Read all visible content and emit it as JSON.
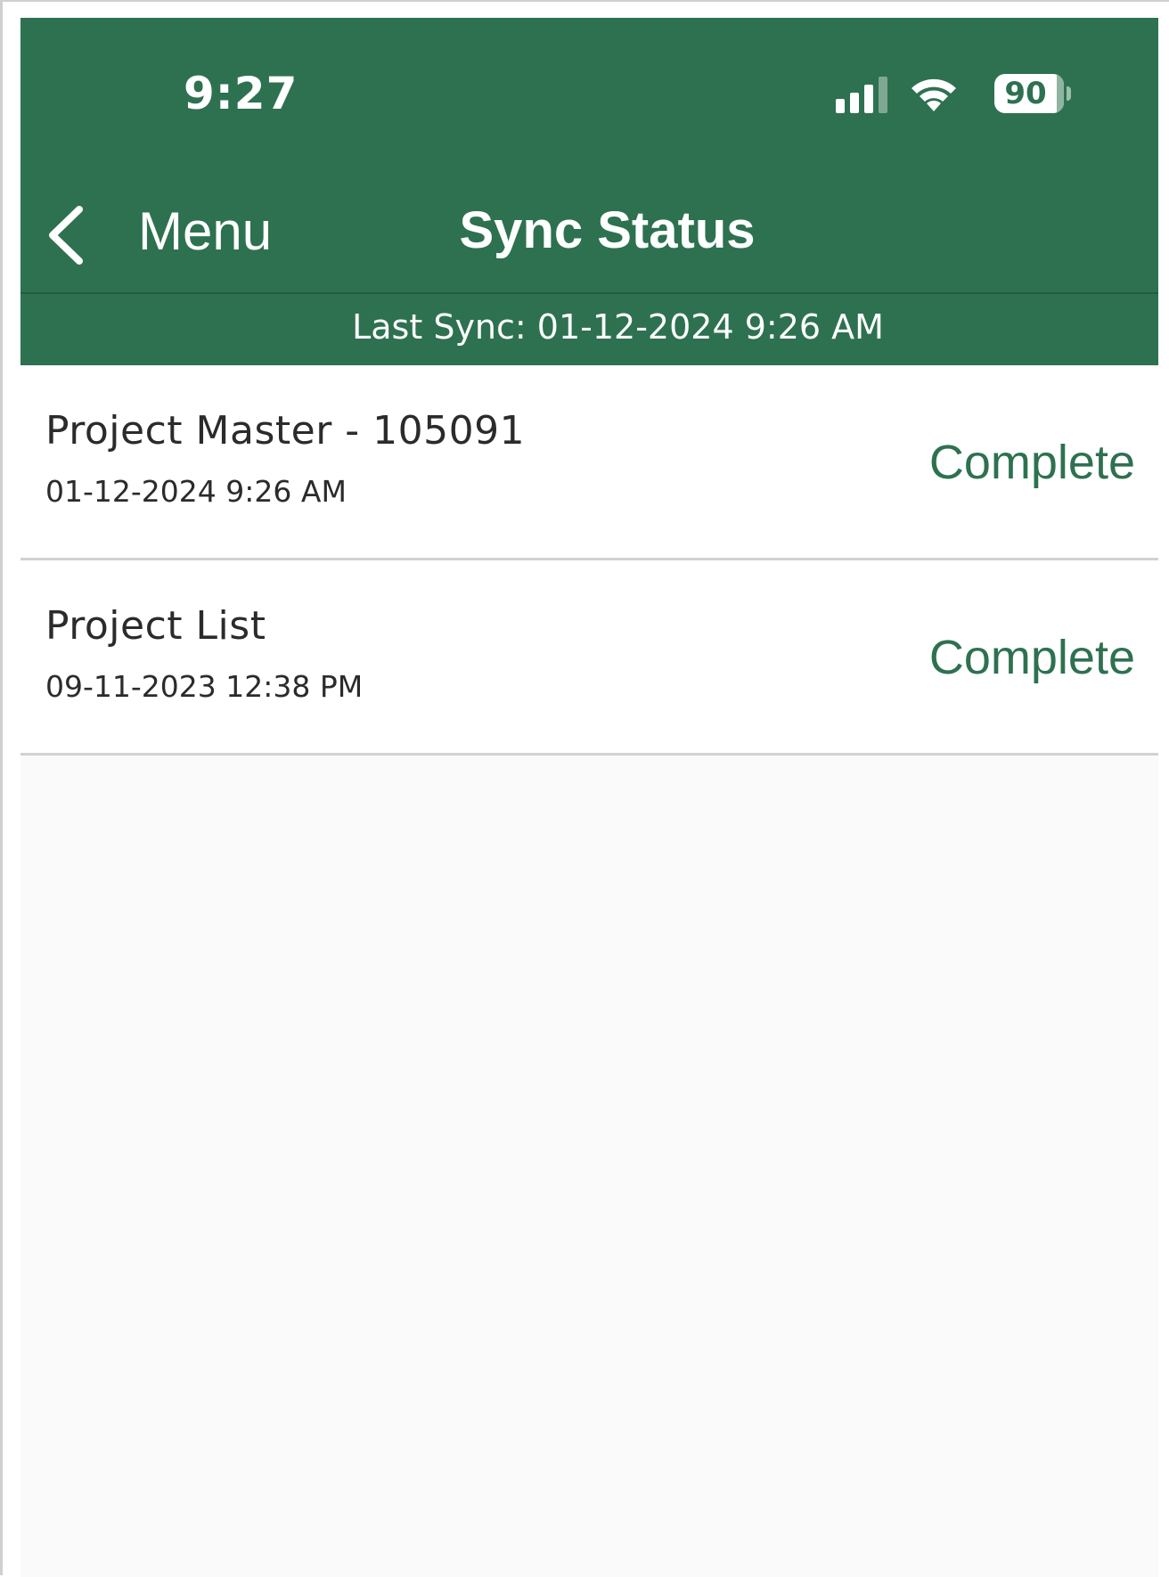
{
  "status_bar": {
    "time": "9:27",
    "battery": "90"
  },
  "nav": {
    "back_label": "Menu",
    "title": "Sync Status"
  },
  "last_sync": "Last Sync: 01-12-2024 9:26 AM",
  "items": [
    {
      "title": "Project Master - 105091",
      "date": "01-12-2024 9:26 AM",
      "status": "Complete"
    },
    {
      "title": "Project List",
      "date": "09-11-2023 12:38 PM",
      "status": "Complete"
    }
  ],
  "colors": {
    "header": "#2e7150",
    "status_text": "#2e7150"
  },
  "icons": {
    "signal": "signal-icon",
    "wifi": "wifi-icon",
    "battery": "battery-icon",
    "back": "chevron-left-icon"
  }
}
